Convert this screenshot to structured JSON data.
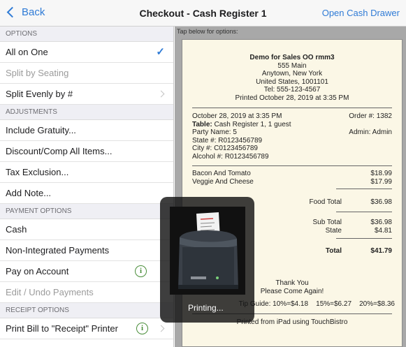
{
  "nav": {
    "back_label": "Back",
    "title": "Checkout - Cash Register 1",
    "right_label": "Open Cash Drawer"
  },
  "sidebar": {
    "options_header": "OPTIONS",
    "options": [
      {
        "label": "All on One",
        "checked": true
      },
      {
        "label": "Split by Seating",
        "dim": true
      },
      {
        "label": "Split Evenly by #",
        "chevron": true
      }
    ],
    "adjustments_header": "ADJUSTMENTS",
    "adjustments": [
      {
        "label": "Include Gratuity..."
      },
      {
        "label": "Discount/Comp All Items..."
      },
      {
        "label": "Tax Exclusion..."
      },
      {
        "label": "Add Note..."
      }
    ],
    "payment_header": "PAYMENT OPTIONS",
    "payments": [
      {
        "label": "Cash"
      },
      {
        "label": "Non-Integrated Payments"
      },
      {
        "label": "Pay on Account",
        "info": true
      },
      {
        "label": "Edit / Undo Payments",
        "dim": true
      }
    ],
    "receipt_header": "RECEIPT OPTIONS",
    "receipt_options": [
      {
        "label": "Print Bill to \"Receipt\" Printer",
        "info": true,
        "chevron": true
      }
    ]
  },
  "main": {
    "hint": "Tap below for options:"
  },
  "receipt": {
    "business": "Demo for Sales OO rmm3",
    "address1": "555 Main",
    "address2": "Anytown, New York",
    "address3": "United States, 1001101",
    "tel": "Tel: 555-123-4567",
    "printed": "Printed October 28, 2019 at 3:35 PM",
    "date": "October 28, 2019 at 3:35 PM",
    "order": "Order #: 1382",
    "table_label": "Table:",
    "table_value": " Cash Register 1, 1 guest",
    "party": "Party Name: 5",
    "admin": "Admin: Admin",
    "state_no": "State #: R0123456789",
    "city_no": "City #: C0123456789",
    "alcohol_no": "Alcohol #: R0123456789",
    "items": [
      {
        "name": "Bacon And Tomato",
        "price": "$18.99"
      },
      {
        "name": "Veggie And Cheese",
        "price": "$17.99"
      }
    ],
    "food_total_label": "Food Total",
    "food_total": "$36.98",
    "subtotal_label": "Sub Total",
    "subtotal": "$36.98",
    "state_label": "State",
    "state_tax": "$4.81",
    "total_label": "Total",
    "total": "$41.79",
    "thanks1": "Thank You",
    "thanks2": "Please Come Again!",
    "tip_guide": "Tip Guide: 10%=$4.18    15%=$6.27    20%=$8.36",
    "footer": "Printed from iPad using TouchBistro"
  },
  "overlay": {
    "label": "Printing..."
  },
  "colors": {
    "accent": "#2f7bd6",
    "info_green": "#4a8e3a"
  }
}
